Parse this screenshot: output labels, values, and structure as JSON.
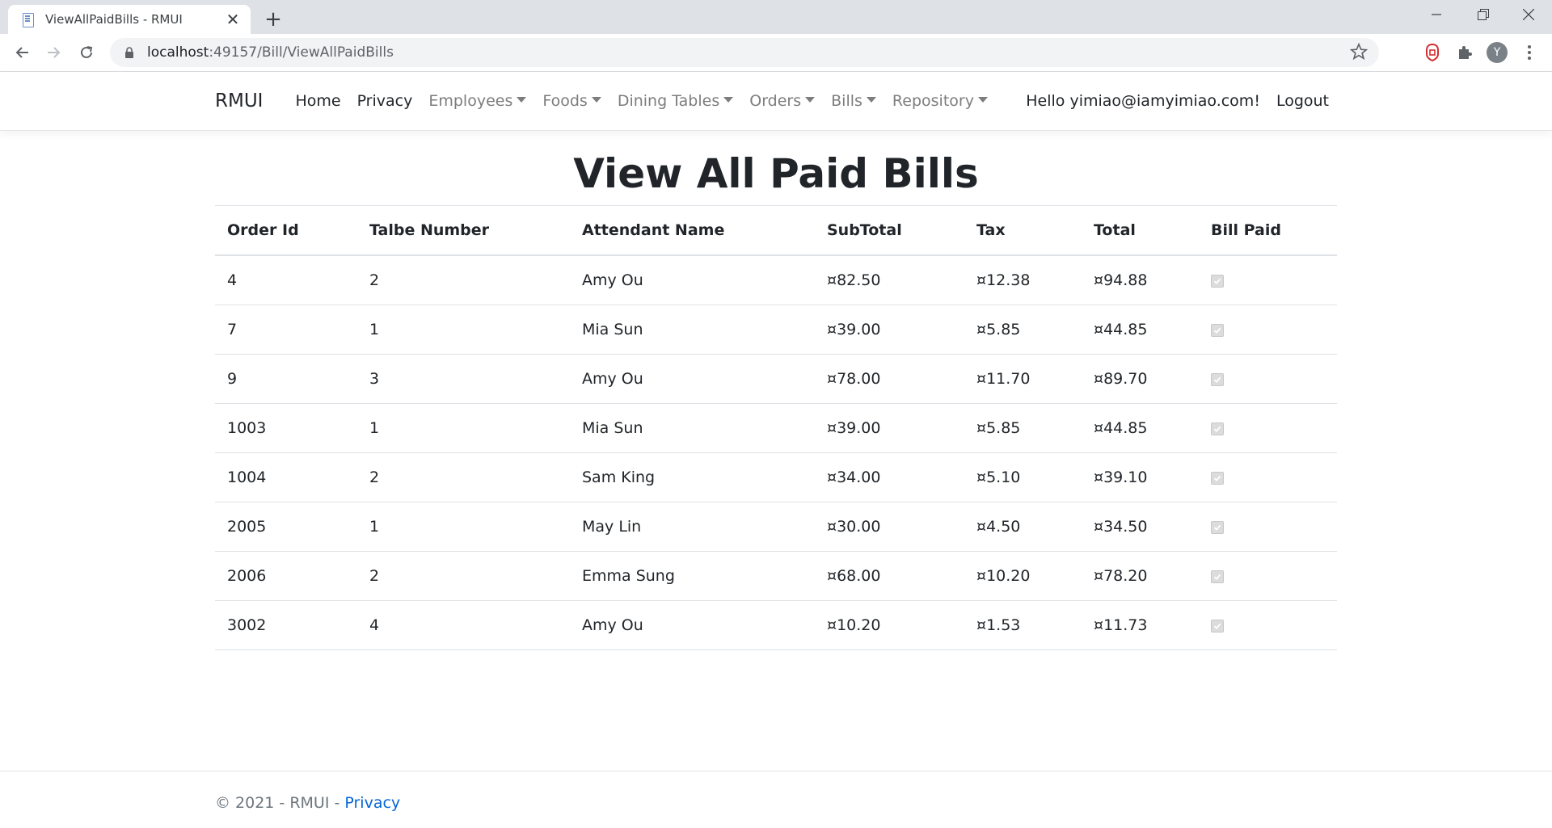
{
  "browser": {
    "tab_title": "ViewAllPaidBills - RMUI",
    "url_host": "localhost",
    "url_path": ":49157/Bill/ViewAllPaidBills",
    "avatar_letter": "Y"
  },
  "navbar": {
    "brand": "RMUI",
    "links": [
      "Home",
      "Privacy"
    ],
    "dropdowns": [
      "Employees",
      "Foods",
      "Dining Tables",
      "Orders",
      "Bills",
      "Repository"
    ],
    "greeting": "Hello yimiao@iamyimiao.com!",
    "logout": "Logout"
  },
  "page": {
    "title": "View All Paid Bills",
    "columns": [
      "Order Id",
      "Talbe Number",
      "Attendant Name",
      "SubTotal",
      "Tax",
      "Total",
      "Bill Paid"
    ],
    "rows": [
      {
        "order_id": "4",
        "table": "2",
        "attendant": "Amy Ou",
        "subtotal": "¤82.50",
        "tax": "¤12.38",
        "total": "¤94.88",
        "paid": true
      },
      {
        "order_id": "7",
        "table": "1",
        "attendant": "Mia Sun",
        "subtotal": "¤39.00",
        "tax": "¤5.85",
        "total": "¤44.85",
        "paid": true
      },
      {
        "order_id": "9",
        "table": "3",
        "attendant": "Amy Ou",
        "subtotal": "¤78.00",
        "tax": "¤11.70",
        "total": "¤89.70",
        "paid": true
      },
      {
        "order_id": "1003",
        "table": "1",
        "attendant": "Mia Sun",
        "subtotal": "¤39.00",
        "tax": "¤5.85",
        "total": "¤44.85",
        "paid": true
      },
      {
        "order_id": "1004",
        "table": "2",
        "attendant": "Sam King",
        "subtotal": "¤34.00",
        "tax": "¤5.10",
        "total": "¤39.10",
        "paid": true
      },
      {
        "order_id": "2005",
        "table": "1",
        "attendant": "May Lin",
        "subtotal": "¤30.00",
        "tax": "¤4.50",
        "total": "¤34.50",
        "paid": true
      },
      {
        "order_id": "2006",
        "table": "2",
        "attendant": "Emma Sung",
        "subtotal": "¤68.00",
        "tax": "¤10.20",
        "total": "¤78.20",
        "paid": true
      },
      {
        "order_id": "3002",
        "table": "4",
        "attendant": "Amy Ou",
        "subtotal": "¤10.20",
        "tax": "¤1.53",
        "total": "¤11.73",
        "paid": true
      }
    ]
  },
  "footer": {
    "text": "© 2021 - RMUI - ",
    "privacy": "Privacy"
  }
}
